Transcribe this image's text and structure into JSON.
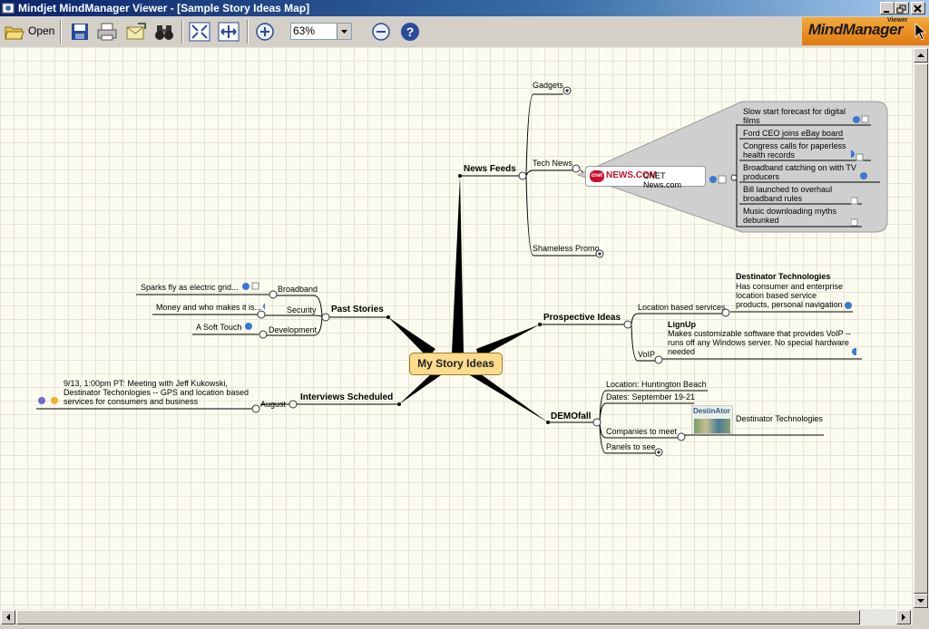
{
  "window": {
    "title": "Mindjet MindManager Viewer - [Sample Story Ideas Map]"
  },
  "toolbar": {
    "open_label": "Open",
    "zoom_value": "63%"
  },
  "logo": {
    "text": "MindManager",
    "viewer_tag": "Viewer"
  },
  "map": {
    "central": "My Story Ideas",
    "news_feeds": {
      "label": "News Feeds",
      "gadgets": "Gadgets",
      "tech_news": "Tech News",
      "shameless_promo": "Shameless Promo",
      "cnet": {
        "logo": "NEWS.COM",
        "badge": "cnet",
        "name": "CNET News.com"
      },
      "stories": [
        "Slow start forecast for digital films",
        "Ford CEO joins eBay board",
        "Congress calls for paperless health records",
        "Broadband catching on with TV producers",
        "Bill launched to overhaul broadband rules",
        "Music downloading myths debunked"
      ]
    },
    "past_stories": {
      "label": "Past Stories",
      "broadband": "Broadband",
      "broadband_story": "Sparks fly as electric grid...",
      "security": "Security",
      "security_story": "Money and who makes it is...",
      "development": "Development",
      "development_story": "A Soft Touch"
    },
    "prospective": {
      "label": "Prospective Ideas",
      "location": "Location based services",
      "destinator_title": "Destinator Technologies",
      "destinator_desc": "Has consumer and enterprise location based service products, personal navigation",
      "voip": "VoIP",
      "lignup_title": "LignUp",
      "lignup_desc": "Makes customizable software that provides VoIP -- runs off any Windows server. No special hardware needed"
    },
    "interviews": {
      "label": "Interviews Scheduled",
      "august": "August",
      "meeting": "9/13, 1:00pm PT: Meeting with Jeff Kukowski, Destinator Techonlogies -- GPS and location based services for consumers and business"
    },
    "demofall": {
      "label": "DEMOfall",
      "location": "Location: Huntington Beach",
      "dates": "Dates: September 19-21",
      "companies": "Companies to meet",
      "company_logo": "DestinAtor",
      "company_name": "Destinator Technologies",
      "panels": "Panels to see"
    }
  }
}
